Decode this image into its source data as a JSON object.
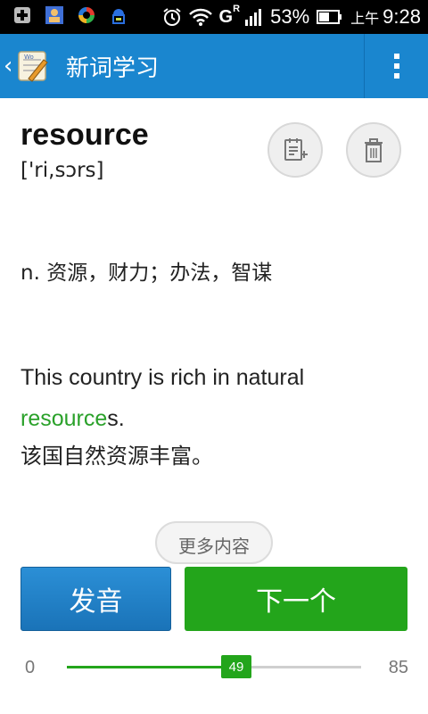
{
  "status_bar": {
    "battery": "53%",
    "time_prefix": "上午",
    "time": "9:28",
    "network_badge": "G",
    "network_badge_sup": "R",
    "icons": [
      "notification-plus-icon",
      "contacts-icon",
      "sync-app-icon",
      "android-app-icon",
      "alarm-icon",
      "wifi-icon",
      "signal-icon",
      "battery-icon"
    ]
  },
  "app_bar": {
    "title": "新词学习",
    "back_icon": "chevron-left-icon",
    "app_icon": "notepad-pencil-icon",
    "menu_icon": "overflow-menu-icon"
  },
  "word": {
    "text": "resource",
    "phonetic": "['ri,sɔrs]",
    "definition": "n. 资源，财力；办法，智谋"
  },
  "example": {
    "before": "This country is rich in natural ",
    "highlight": "resource",
    "after": "s.",
    "translation": "该国自然资源丰富。"
  },
  "actions": {
    "add_icon": "add-to-notebook-icon",
    "delete_icon": "trash-icon",
    "more_label": "更多内容",
    "speak_label": "发音",
    "next_label": "下一个"
  },
  "progress": {
    "min": "0",
    "max": "85",
    "current": "49",
    "value": 49,
    "total": 85
  },
  "colors": {
    "app_bar": "#1a86cf",
    "accent_green": "#23a51b",
    "highlight_green": "#2aa12a",
    "button_blue": "#1a73b8"
  }
}
